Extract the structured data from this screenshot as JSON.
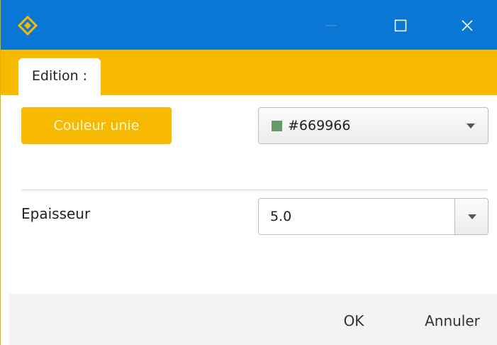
{
  "window": {
    "logo_icon": "diamond-logo-icon",
    "controls": [
      "minimize-icon",
      "maximize-icon",
      "close-icon"
    ],
    "colors": {
      "titlebar": "#0a77d4",
      "accent": "#f8ba00",
      "logo": "#f8ba00"
    }
  },
  "tabs": [
    {
      "label": "Edition :"
    }
  ],
  "fill": {
    "mode_label": "Couleur unie",
    "color_value": "#669966",
    "swatch_color": "#669966"
  },
  "thickness": {
    "label": "Epaisseur",
    "value": "5.0"
  },
  "footer": {
    "ok_label": "OK",
    "cancel_label": "Annuler"
  }
}
